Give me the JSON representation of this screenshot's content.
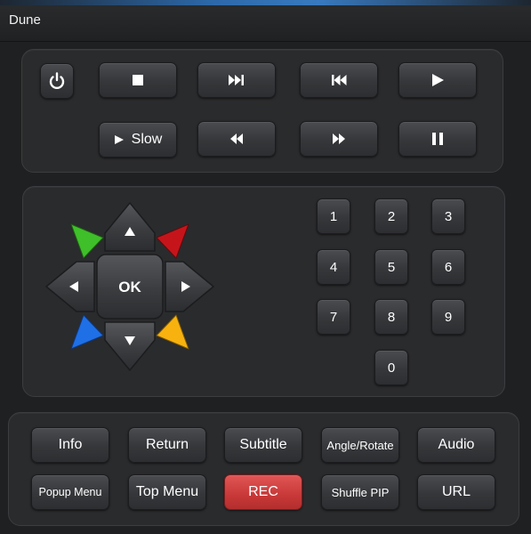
{
  "window": {
    "title": "Dune"
  },
  "transport": {
    "power_icon": "power-icon",
    "stop_icon": "stop-icon",
    "next_icon": "skip-next-icon",
    "prev_icon": "skip-previous-icon",
    "play_icon": "play-icon",
    "slow_label": "Slow",
    "slow_icon": "play-icon",
    "rewind_icon": "rewind-icon",
    "fast_forward_icon": "fast-forward-icon",
    "pause_icon": "pause-icon"
  },
  "dpad": {
    "ok_label": "OK",
    "color_keys": {
      "green": "#3fbf2a",
      "red": "#c5151b",
      "blue": "#1f6fe6",
      "yellow": "#f7b20f"
    }
  },
  "numpad": {
    "keys": [
      "1",
      "2",
      "3",
      "4",
      "5",
      "6",
      "7",
      "8",
      "9",
      "0"
    ]
  },
  "bottom": {
    "info": "Info",
    "return": "Return",
    "subtitle": "Subtitle",
    "angle_rotate": "Angle/Rotate",
    "audio": "Audio",
    "popup_menu": "Popup Menu",
    "top_menu": "Top Menu",
    "rec": "REC",
    "shuffle_pip": "Shuffle PIP",
    "url": "URL"
  }
}
